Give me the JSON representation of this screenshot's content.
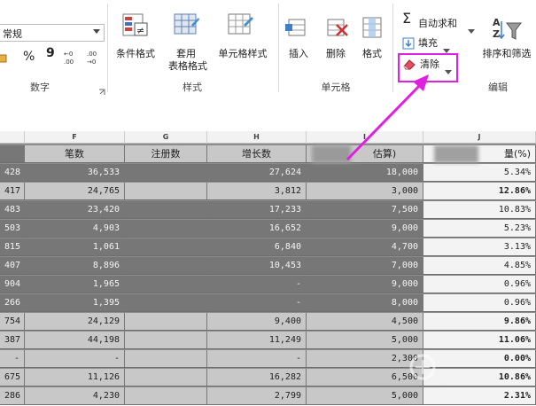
{
  "ribbon": {
    "number_format": "常规",
    "number_group_label": "数字",
    "number_buttons": [
      "%",
      "9"
    ],
    "styles_group_label": "样式",
    "conditional_format": "条件格式",
    "table_format_line1": "套用",
    "table_format_line2": "表格格式",
    "cell_styles": "单元格样式",
    "cells_group_label": "单元格",
    "insert": "插入",
    "delete": "删除",
    "format": "格式",
    "editing_group_label": "编辑",
    "autosum": "自动求和",
    "fill": "填充",
    "clear": "清除",
    "sort_filter": "排序和筛选"
  },
  "columns": [
    "F",
    "G",
    "H",
    "I",
    "J"
  ],
  "header_row": {
    "e": "",
    "f": "笔数",
    "g": "注册数",
    "h": "增长数",
    "i": "估算)",
    "j": "量(%)"
  },
  "rows": [
    {
      "style": "dark",
      "e": "428",
      "f": "36,533",
      "g": "",
      "h": "27,624",
      "i": "18,000",
      "j": "5.34%"
    },
    {
      "style": "light",
      "e": "417",
      "f": "24,765",
      "g": "",
      "h": "3,812",
      "i": "3,000",
      "j": "12.86%"
    },
    {
      "style": "dark",
      "e": "483",
      "f": "23,420",
      "g": "",
      "h": "17,233",
      "i": "7,500",
      "j": "10.83%"
    },
    {
      "style": "dark",
      "e": "503",
      "f": "4,903",
      "g": "",
      "h": "16,652",
      "i": "9,000",
      "j": "5.23%"
    },
    {
      "style": "dark",
      "e": "815",
      "f": "1,061",
      "g": "",
      "h": "6,840",
      "i": "4,700",
      "j": "3.13%"
    },
    {
      "style": "dark",
      "e": "407",
      "f": "8,896",
      "g": "",
      "h": "10,453",
      "i": "7,000",
      "j": "4.85%"
    },
    {
      "style": "dark",
      "e": "904",
      "f": "1,965",
      "g": "",
      "h": "-",
      "i": "9,000",
      "j": "0.96%"
    },
    {
      "style": "dark",
      "e": "266",
      "f": "1,395",
      "g": "",
      "h": "-",
      "i": "8,000",
      "j": "0.96%"
    },
    {
      "style": "light",
      "e": "754",
      "f": "24,129",
      "g": "",
      "h": "9,400",
      "i": "4,500",
      "j": "9.86%"
    },
    {
      "style": "light",
      "e": "387",
      "f": "44,198",
      "g": "",
      "h": "11,249",
      "i": "5,000",
      "j": "11.06%"
    },
    {
      "style": "light",
      "e": "-",
      "f": "-",
      "g": "",
      "h": "-",
      "i": "2,300",
      "j": "0.00%"
    },
    {
      "style": "light",
      "e": "675",
      "f": "11,126",
      "g": "",
      "h": "16,282",
      "i": "6,500",
      "j": "10.86%"
    },
    {
      "style": "light",
      "e": "286",
      "f": "4,230",
      "g": "",
      "h": "2,799",
      "i": "5,000",
      "j": "2.31%"
    }
  ],
  "colors": {
    "highlight": "#e020e0",
    "dark_row": "#777777",
    "light_row": "#c8c8c8"
  }
}
